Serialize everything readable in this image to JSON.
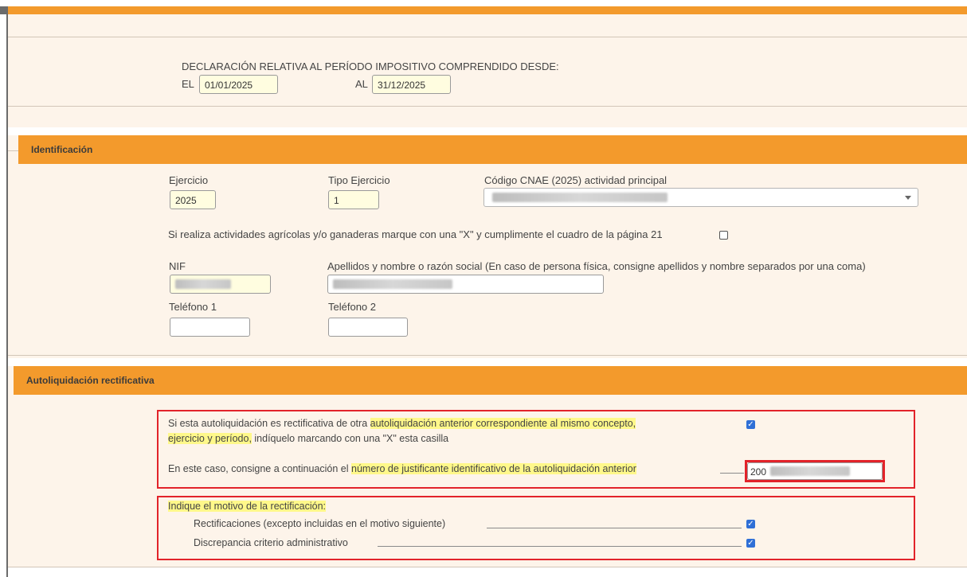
{
  "header": {
    "period_label": "DECLARACIÓN RELATIVA AL PERÍODO IMPOSITIVO COMPRENDIDO DESDE:",
    "from_label": "EL",
    "from_value": "01/01/2025",
    "to_label": "AL",
    "to_value": "31/12/2025"
  },
  "identificacion": {
    "title": "Identificación",
    "ejercicio_label": "Ejercicio",
    "ejercicio_value": "2025",
    "tipo_label": "Tipo Ejercicio",
    "tipo_value": "1",
    "cnae_label": "Código CNAE (2025) actividad principal",
    "agricola_text": "Si realiza actividades agrícolas y/o ganaderas marque con una \"X\" y cumplimente el cuadro de la página 21",
    "nif_label": "NIF",
    "apellidos_label": "Apellidos y nombre o razón social (En caso de persona física, consigne apellidos y nombre separados por una coma)",
    "tel1_label": "Teléfono 1",
    "tel2_label": "Teléfono 2"
  },
  "rectificativa": {
    "title": "Autoliquidación rectificativa",
    "q1_part1": "Si esta autoliquidación es rectificativa de otra ",
    "q1_hl1": "autoliquidación anterior correspondiente al mismo concepto,",
    "q1_hl2": "ejercicio y período,",
    "q1_part2": " indíquelo marcando con una \"X\" esta casilla",
    "q2_part1": "En este caso, consigne a continuación el ",
    "q2_hl": "número de justificante identificativo de la autoliquidación anterior",
    "justificante_value": "200",
    "motivo_label": "Indique el motivo de la rectificación:",
    "motivo1": "Rectificaciones (excepto incluidas en el motivo siguiente)",
    "motivo2": "Discrepancia criterio administrativo",
    "checkbox_color": "#2f6fd6",
    "highlight_color": "#fff88a",
    "box_color": "#e2232a"
  }
}
